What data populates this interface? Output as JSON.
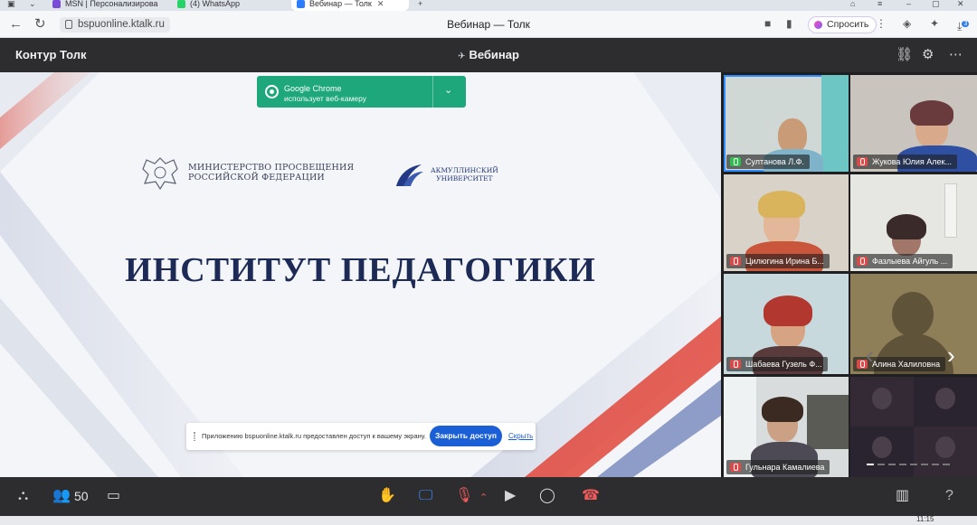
{
  "browser": {
    "tabs": [
      {
        "title": "MSN | Персонализирова",
        "favicon_color": "#7a4bd8"
      },
      {
        "title": "(4) WhatsApp",
        "favicon_color": "#25d366"
      },
      {
        "title": "Вебинар — Толк",
        "favicon_color": "#2b7cff",
        "active": true
      }
    ],
    "new_tab_glyph": "+",
    "close_glyph": "✕",
    "url": "bspuonline.ktalk.ru",
    "page_title": "Вебинар — Толк",
    "ask_button": "Спросить",
    "toolbar_icons": [
      "camera-icon",
      "bookmark-icon",
      "menu-icon",
      "shield-icon",
      "extension-icon",
      "download-icon"
    ],
    "download_badge": "3"
  },
  "app": {
    "brand": "Контур Толк",
    "room_title": "Вебинар",
    "header_icons": [
      "link-icon",
      "settings-icon",
      "more-icon"
    ]
  },
  "slide": {
    "ministry_line1": "МИНИСТЕРСТВО ПРОСВЕЩЕНИЯ",
    "ministry_line2": "РОССИЙСКОЙ ФЕДЕРАЦИИ",
    "university_line1": "АКМУЛЛИНСКИЙ",
    "university_line2": "УНИВЕРСИТЕТ",
    "headline": "ИНСТИТУТ ПЕДАГОГИКИ"
  },
  "webcam_notice": {
    "app": "Google Chrome",
    "message": "использует веб-камеру"
  },
  "share_bar": {
    "message": "Приложению bspuonline.ktalk.ru предоставлен доступ к вашему экрану.",
    "stop_label": "Закрыть доступ",
    "hide_label": "Скрыть"
  },
  "participants": [
    {
      "name": "Султанова Л.Ф.",
      "mic": "on",
      "speaking": true
    },
    {
      "name": "Жукова Юлия Алек...",
      "mic": "off"
    },
    {
      "name": "Цилюгина Ирина Б...",
      "mic": "off"
    },
    {
      "name": "Фазлыева Айгуль ...",
      "mic": "off"
    },
    {
      "name": "Шабаева Гузель Ф...",
      "mic": "off"
    },
    {
      "name": "Алина Халиловна",
      "mic": "off",
      "avatar": true
    },
    {
      "name": "Гульнара Камалиева",
      "mic": "off"
    }
  ],
  "carousel": {
    "prev": "‹",
    "next": "›",
    "pages": 8,
    "current": 1
  },
  "controls": {
    "participant_count": "50",
    "help": "?"
  },
  "taskbar": {
    "time": "11:15"
  }
}
